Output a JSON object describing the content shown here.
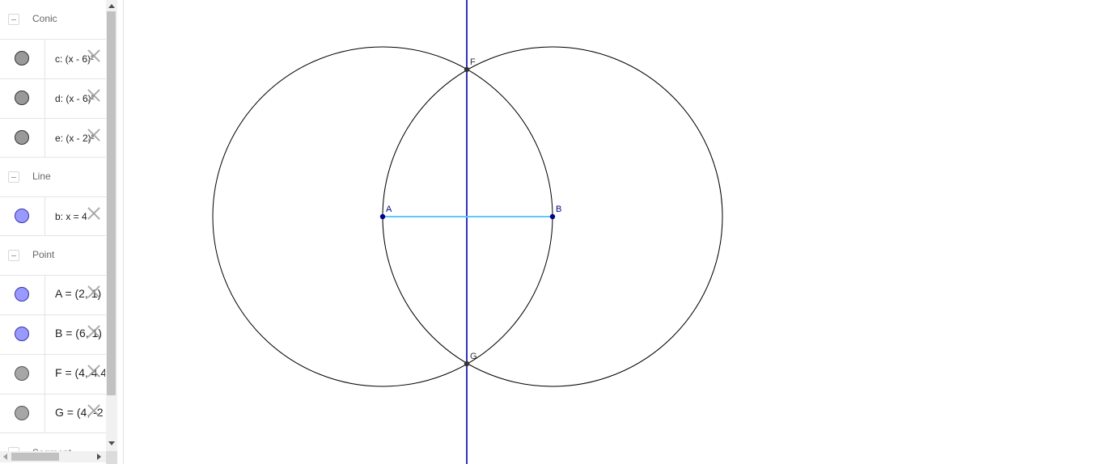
{
  "algebra": {
    "groups": [
      {
        "label": "Conic",
        "items": [
          {
            "expr": "c: (x - 6)²",
            "color": "#999999"
          },
          {
            "expr": "d: (x - 6)²",
            "color": "#999999"
          },
          {
            "expr": "e: (x - 2)²",
            "color": "#999999"
          }
        ]
      },
      {
        "label": "Line",
        "items": [
          {
            "expr": "b: x = 4",
            "color": "#9999ff"
          }
        ]
      },
      {
        "label": "Point",
        "items": [
          {
            "expr": "A = (2, 1)",
            "color": "#9999ff"
          },
          {
            "expr": "B = (6, 1)",
            "color": "#9999ff"
          },
          {
            "expr": "F = (4, 4.4",
            "color": "#a6a6a6"
          },
          {
            "expr": "G = (4, -2",
            "color": "#a6a6a6"
          }
        ]
      },
      {
        "label": "Segment",
        "items": []
      }
    ]
  },
  "graphics": {
    "points": {
      "A": {
        "label": "A",
        "color": "#00008b"
      },
      "B": {
        "label": "B",
        "color": "#00008b"
      },
      "F": {
        "label": "F",
        "color": "#333333"
      },
      "G": {
        "label": "G",
        "color": "#333333"
      }
    },
    "line_color": "#0000b3",
    "segment_color": "#5cc8ff",
    "circle_color": "#000000"
  }
}
